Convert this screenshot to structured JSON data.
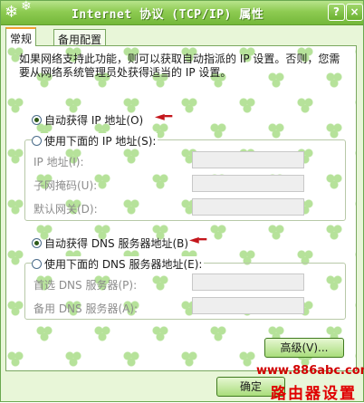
{
  "window": {
    "title": "Internet 协议 (TCP/IP) 属性",
    "help_button": "?",
    "close_button": "×"
  },
  "tabs": [
    {
      "label": "常规",
      "active": true
    },
    {
      "label": "备用配置",
      "active": false
    }
  ],
  "description": "如果网络支持此功能，则可以获取自动指派的 IP 设置。否则，您需要从网络系统管理员处获得适当的 IP 设置。",
  "ip": {
    "auto_label": "自动获得 IP 地址(O)",
    "auto_checked": true,
    "manual_label": "使用下面的 IP 地址(S):",
    "manual_checked": false,
    "fields": [
      {
        "label": "IP 地址(I):",
        "value": ""
      },
      {
        "label": "子网掩码(U):",
        "value": ""
      },
      {
        "label": "默认网关(D):",
        "value": ""
      }
    ]
  },
  "dns": {
    "auto_label": "自动获得 DNS 服务器地址(B)",
    "auto_checked": true,
    "manual_label": "使用下面的 DNS 服务器地址(E):",
    "manual_checked": false,
    "fields": [
      {
        "label": "首选 DNS 服务器(P):",
        "value": ""
      },
      {
        "label": "备用 DNS 服务器(A):",
        "value": ""
      }
    ]
  },
  "buttons": {
    "advanced": "高级(V)...",
    "ok": "确定"
  },
  "watermark": {
    "url": "www.886abc.com",
    "text": "路由器设置"
  },
  "colors": {
    "titlebar": "#8ecb52",
    "arrow": "#c4161c",
    "watermark": "#d10000"
  }
}
